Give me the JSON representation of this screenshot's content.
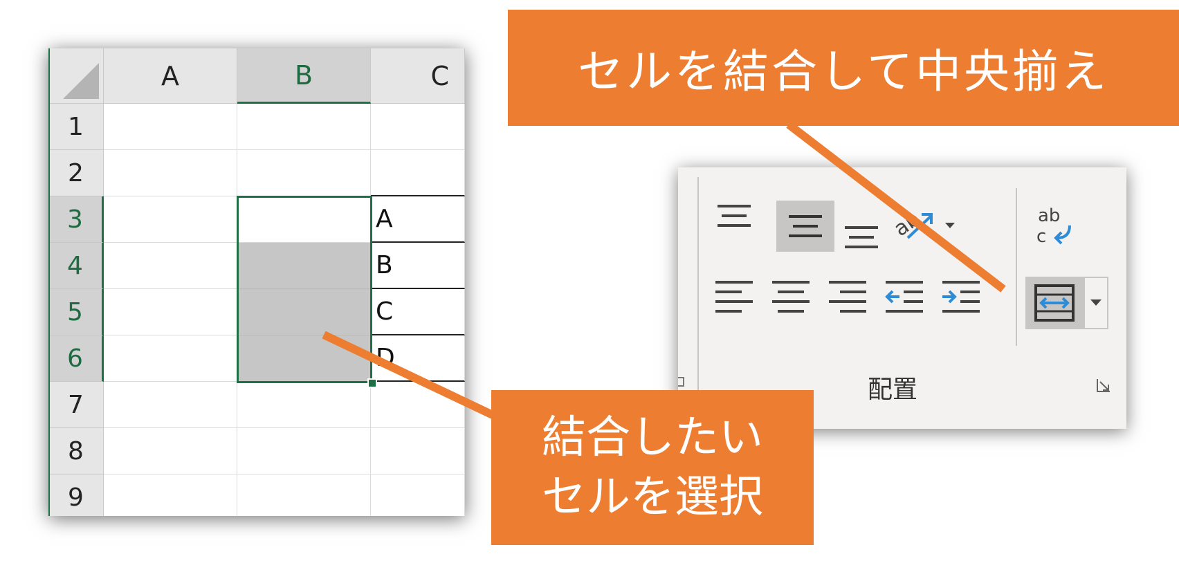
{
  "sheet": {
    "columns": [
      "A",
      "B",
      "C"
    ],
    "rows": [
      "1",
      "2",
      "3",
      "4",
      "5",
      "6",
      "7",
      "8",
      "9"
    ],
    "column_c_values": [
      "A",
      "B",
      "C",
      "D"
    ]
  },
  "ribbon": {
    "group_label": "配置",
    "wrap_text_icon_text": "ab c"
  },
  "callouts": {
    "top": "セルを結合して中央揃え",
    "bottom_line1": "結合したい",
    "bottom_line2": "セルを選択"
  },
  "colors": {
    "callout": "#ed7d31",
    "selection": "#1e7145",
    "header_bg": "#e6e6e6",
    "selected_fill": "#c6c6c6",
    "ribbon_bg": "#f3f2f1",
    "accent_blue": "#2e8bd6"
  }
}
